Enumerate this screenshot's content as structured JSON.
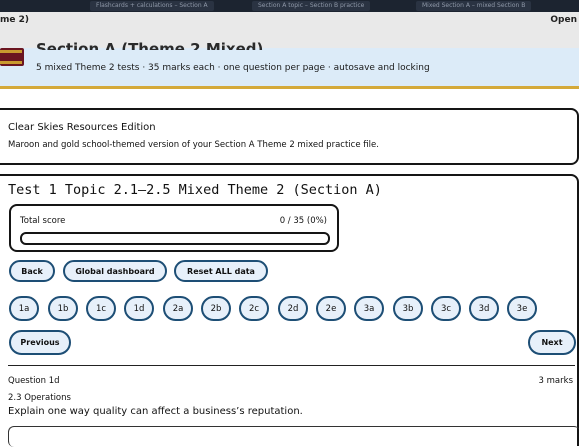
{
  "top_tabs": [
    "Flashcards + calculations – Section A",
    "Section A topic – Section B practice",
    "Mixed Section A – mixed Section B"
  ],
  "overlay": {
    "title": "me 2)",
    "open_label": "Open"
  },
  "header": {
    "title": "Section A (Theme 2 Mixed)",
    "subtitle": "5 mixed Theme 2 tests · 35 marks each · one question per page · autosave and locking"
  },
  "edition": {
    "title": "Clear Skies Resources Edition",
    "description": "Maroon and gold school-themed version of your Section A Theme 2 mixed practice file."
  },
  "test": {
    "title": "Test 1 Topic 2.1–2.5 Mixed Theme 2 (Section A)",
    "score_label": "Total score",
    "score_value": "0 / 35 (0%)",
    "score_fraction": 0
  },
  "controls": {
    "back": "Back",
    "dashboard": "Global dashboard",
    "reset": "Reset ALL data",
    "previous": "Previous",
    "next": "Next"
  },
  "question_tabs": [
    "1a",
    "1b",
    "1c",
    "1d",
    "2a",
    "2b",
    "2c",
    "2d",
    "2e",
    "3a",
    "3b",
    "3c",
    "3d",
    "3e"
  ],
  "question": {
    "label": "Question 1d",
    "marks": "3 marks",
    "topic": "2.3 Operations",
    "text": "Explain one way quality can affect a business’s reputation."
  },
  "colors": {
    "accent_blue": "#1d4e75",
    "gold": "#d4a93a",
    "maroon": "#8a1c2b"
  }
}
